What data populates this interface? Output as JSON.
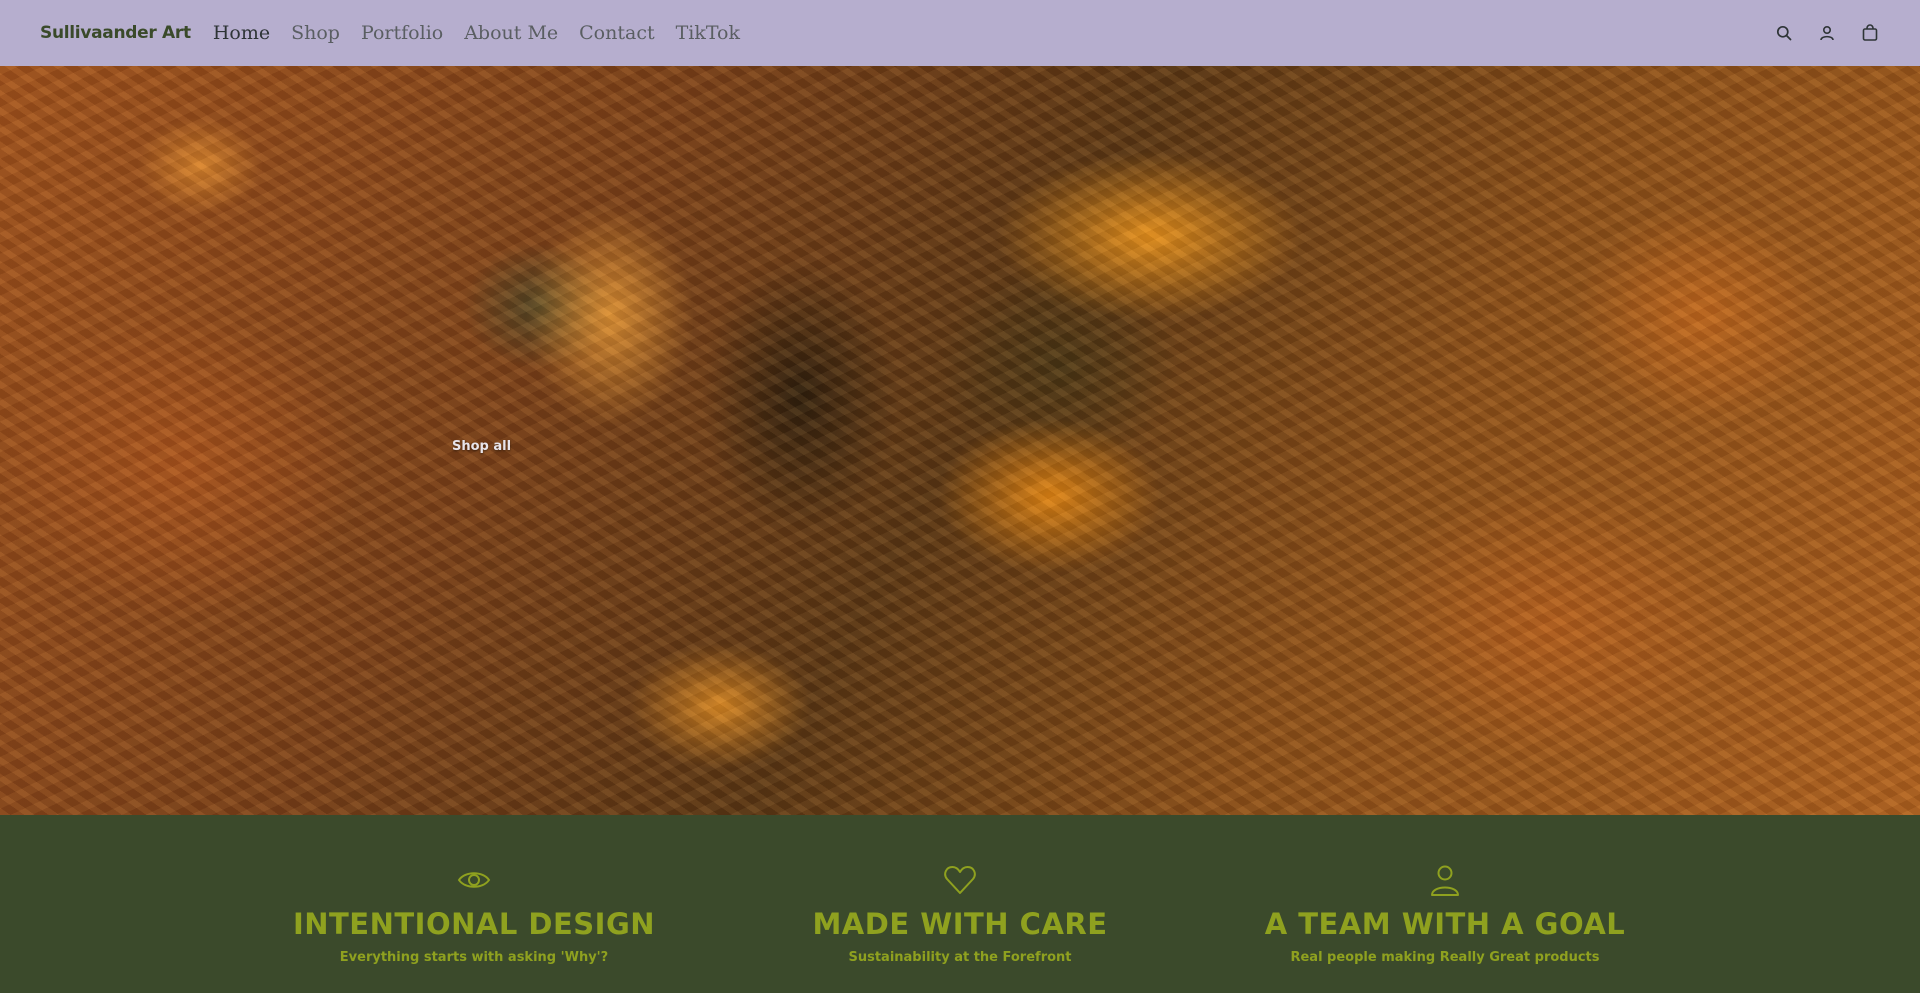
{
  "brand": {
    "name": "Sullivaander Art"
  },
  "nav": {
    "items": [
      {
        "label": "Home",
        "active": true
      },
      {
        "label": "Shop"
      },
      {
        "label": "Portfolio"
      },
      {
        "label": "About Me"
      },
      {
        "label": "Contact"
      },
      {
        "label": "TikTok"
      }
    ]
  },
  "header_icons": [
    "search-icon",
    "account-icon",
    "cart-icon"
  ],
  "hero": {
    "cta_label": "Shop all"
  },
  "features": [
    {
      "icon": "eye-icon",
      "title": "INTENTIONAL DESIGN",
      "subtitle": "Everything starts with asking 'Why'?"
    },
    {
      "icon": "heart-icon",
      "title": "MADE WITH CARE",
      "subtitle": "Sustainability at the Forefront"
    },
    {
      "icon": "person-icon",
      "title": "A TEAM WITH A GOAL",
      "subtitle": "Real people making Really Great products"
    }
  ],
  "colors": {
    "header_bg": "#b6aece",
    "features_bg": "#3b4a2b",
    "accent": "#8fa11f"
  }
}
